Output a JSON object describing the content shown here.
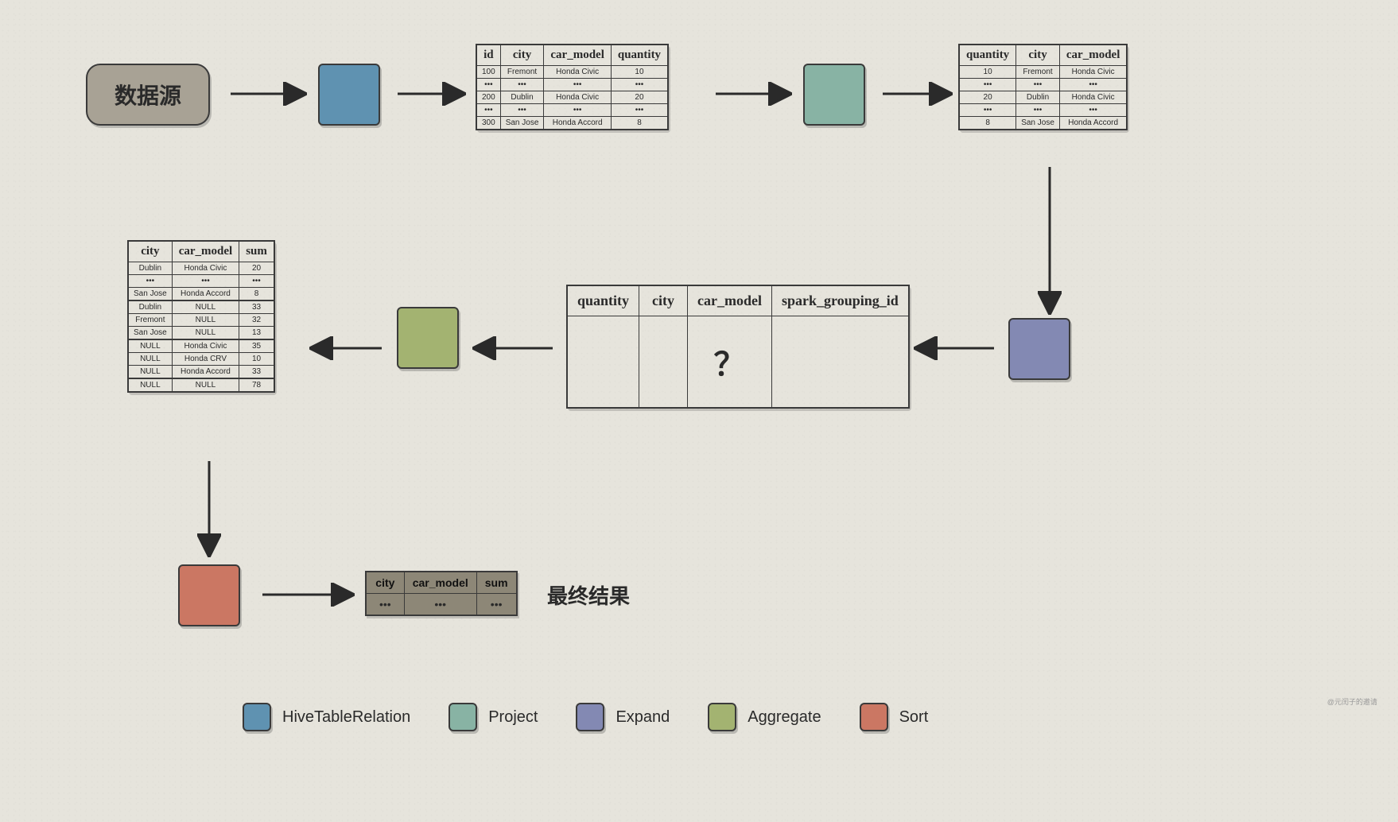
{
  "source_label": "数据源",
  "final_label": "最终结果",
  "watermark": "@元闰子的邀请",
  "legend": {
    "hive": "HiveTableRelation",
    "project": "Project",
    "expand": "Expand",
    "aggregate": "Aggregate",
    "sort": "Sort"
  },
  "table1": {
    "headers": [
      "id",
      "city",
      "car_model",
      "quantity"
    ],
    "rows": [
      [
        "100",
        "Fremont",
        "Honda Civic",
        "10"
      ],
      [
        "•••",
        "•••",
        "•••",
        "•••"
      ],
      [
        "200",
        "Dublin",
        "Honda Civic",
        "20"
      ],
      [
        "•••",
        "•••",
        "•••",
        "•••"
      ],
      [
        "300",
        "San Jose",
        "Honda Accord",
        "8"
      ]
    ]
  },
  "table2": {
    "headers": [
      "quantity",
      "city",
      "car_model"
    ],
    "rows": [
      [
        "10",
        "Fremont",
        "Honda Civic"
      ],
      [
        "•••",
        "•••",
        "•••"
      ],
      [
        "20",
        "Dublin",
        "Honda Civic"
      ],
      [
        "•••",
        "•••",
        "•••"
      ],
      [
        "8",
        "San Jose",
        "Honda Accord"
      ]
    ]
  },
  "table3": {
    "headers": [
      "quantity",
      "city",
      "car_model",
      "spark_grouping_id"
    ],
    "body": "？"
  },
  "table4": {
    "headers": [
      "city",
      "car_model",
      "sum"
    ],
    "groups": [
      [
        [
          "Dublin",
          "Honda Civic",
          "20"
        ],
        [
          "•••",
          "•••",
          "•••"
        ],
        [
          "San Jose",
          "Honda Accord",
          "8"
        ]
      ],
      [
        [
          "Dublin",
          "NULL",
          "33"
        ],
        [
          "Fremont",
          "NULL",
          "32"
        ],
        [
          "San Jose",
          "NULL",
          "13"
        ]
      ],
      [
        [
          "NULL",
          "Honda Civic",
          "35"
        ],
        [
          "NULL",
          "Honda CRV",
          "10"
        ],
        [
          "NULL",
          "Honda Accord",
          "33"
        ]
      ],
      [
        [
          "NULL",
          "NULL",
          "78"
        ]
      ]
    ]
  },
  "table5": {
    "headers": [
      "city",
      "car_model",
      "sum"
    ],
    "row": [
      "•••",
      "•••",
      "•••"
    ]
  }
}
